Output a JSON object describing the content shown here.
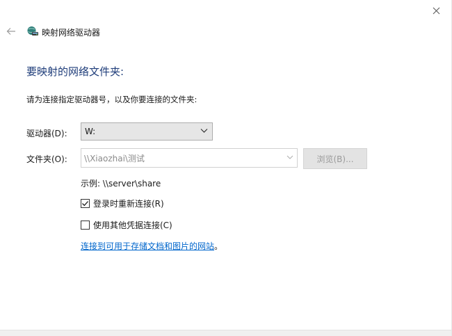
{
  "window": {
    "title": "映射网络驱动器",
    "icons": {
      "close": "close-icon",
      "back": "back-arrow-icon",
      "title": "network-drive-icon"
    }
  },
  "main": {
    "heading": "要映射的网络文件夹:",
    "instruction": "请为连接指定驱动器号，以及你要连接的文件夹:",
    "drive": {
      "label": "驱动器(D):",
      "value": "W:"
    },
    "folder": {
      "label": "文件夹(O):",
      "value": "\\\\Xiaozhai\\测试"
    },
    "browse_label": "浏览(B)...",
    "example": "示例: \\\\server\\share",
    "reconnect": {
      "label": "登录时重新连接(R)",
      "checked": true
    },
    "other_credentials": {
      "label": "使用其他凭据连接(C)",
      "checked": false
    },
    "link": {
      "text": "连接到可用于存储文档和图片的网站",
      "suffix": "。"
    }
  },
  "colors": {
    "heading": "#1f3d7a",
    "link": "#0066cc",
    "disabled_text": "#9a9a9a"
  }
}
